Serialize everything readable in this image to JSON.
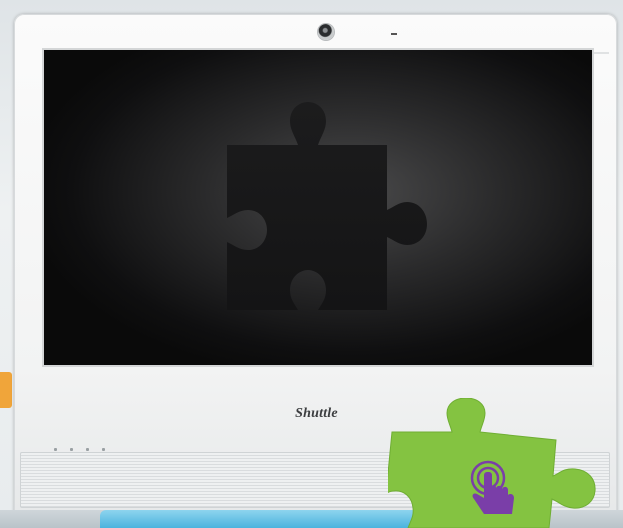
{
  "monitor": {
    "brand": "Shuttle",
    "screen": {
      "content": "puzzle-piece-icon"
    }
  },
  "sticker": {
    "icon": "touch-hand-icon",
    "color": "#84c341",
    "icon_color": "#7a3ea8"
  },
  "colors": {
    "bezel": "#f2f3f3",
    "screen_center": "#4a4a4b",
    "screen_edge": "#0a0a0a",
    "base_blue": "#4ab3de"
  }
}
